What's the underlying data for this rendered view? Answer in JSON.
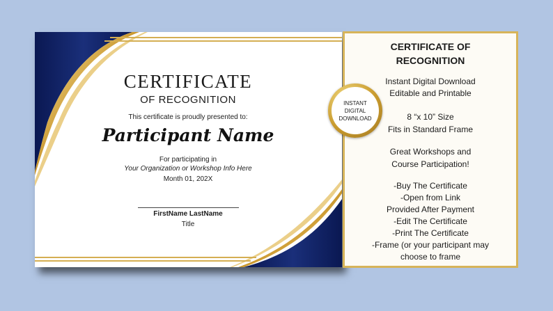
{
  "certificate": {
    "title": "CERTIFICATE",
    "subtitle": "OF RECOGNITION",
    "presented_text": "This certificate is proudly presented to:",
    "participant_name": "Participant Name",
    "participating_text": "For participating in",
    "organization": "Your Organization or Workshop Info Here",
    "date": "Month 01, 202X",
    "signature_name": "FirstName LastName",
    "signature_title": "Title"
  },
  "badge": {
    "lines": [
      "INSTANT",
      "DIGITAL",
      "DOWNLOAD"
    ]
  },
  "info_panel": {
    "title_line1": "CERTIFICATE OF",
    "title_line2": "RECOGNITION",
    "lines": [
      "Instant Digital Download",
      "Editable and Printable",
      "8 “x 10” Size",
      "Fits in Standard Frame",
      "Great Workshops and",
      "Course Participation!",
      "-Buy The Certificate",
      "-Open from Link",
      "Provided After Payment",
      "-Edit The Certificate",
      "-Print The Certificate",
      "-Frame (or your participant may",
      "choose to frame"
    ]
  },
  "colors": {
    "background": "#b1c5e3",
    "navy": "#0f1f5e",
    "gold": "#d7b459",
    "panel_background": "#fdfbf5"
  }
}
